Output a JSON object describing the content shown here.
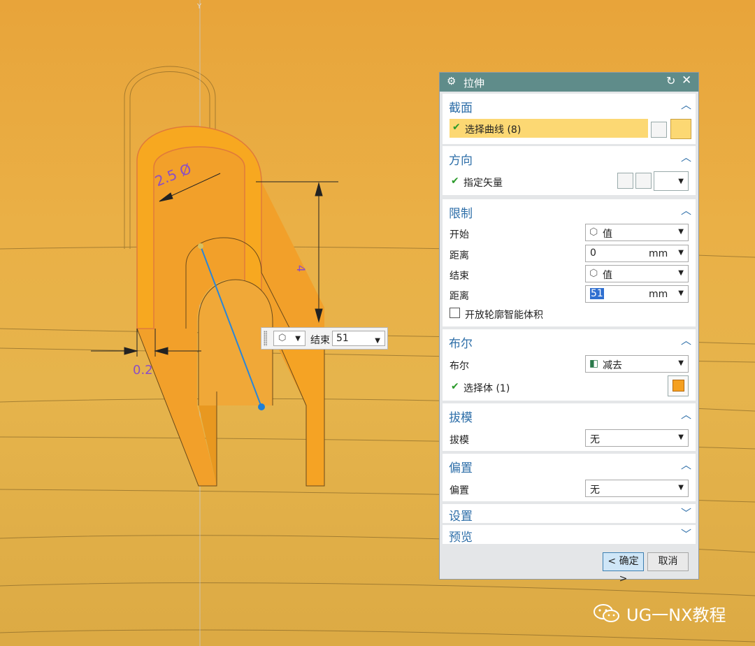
{
  "viewport": {
    "dim_ring_label": "2.5 Ø",
    "dim_height_label": "4",
    "dim_thickness_label": "0.2",
    "axis_label": "Y"
  },
  "mini_toolbar": {
    "label": "结束",
    "value": "51"
  },
  "dialog": {
    "title": "拉伸",
    "sections": {
      "section": {
        "title": "截面",
        "select_curve_label": "选择曲线 (8)"
      },
      "direction": {
        "title": "方向",
        "vector_label": "指定矢量"
      },
      "limits": {
        "title": "限制",
        "start_label": "开始",
        "start_value": "值",
        "start_distance_label": "距离",
        "start_distance": "0",
        "start_unit": "mm",
        "end_label": "结束",
        "end_value": "值",
        "end_distance_label": "距离",
        "end_distance": "51",
        "end_unit": "mm",
        "open_profile_label": "开放轮廓智能体积"
      },
      "boolean": {
        "title": "布尔",
        "boolean_label": "布尔",
        "boolean_value": "减去",
        "select_body_label": "选择体 (1)"
      },
      "draft": {
        "title": "拔模",
        "draft_label": "拔模",
        "draft_value": "无"
      },
      "offset": {
        "title": "偏置",
        "offset_label": "偏置",
        "offset_value": "无"
      },
      "settings": {
        "title": "设置"
      },
      "preview": {
        "title": "预览"
      }
    },
    "ok_label": "< 确定 >",
    "cancel_label": "取消"
  },
  "watermark": {
    "text": "UG一NX教程"
  },
  "colors": {
    "accent": "#2d6ea8",
    "title_bar": "#5f8c8a",
    "model": "#f5a01e",
    "highlight": "#fcd873"
  }
}
